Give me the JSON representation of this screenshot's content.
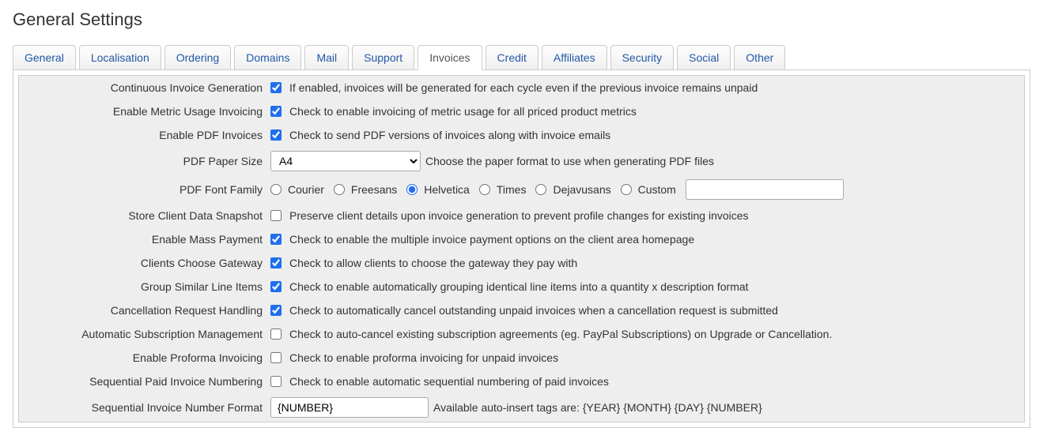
{
  "page_title": "General Settings",
  "tabs": {
    "general": "General",
    "localisation": "Localisation",
    "ordering": "Ordering",
    "domains": "Domains",
    "mail": "Mail",
    "support": "Support",
    "invoices": "Invoices",
    "credit": "Credit",
    "affiliates": "Affiliates",
    "security": "Security",
    "social": "Social",
    "other": "Other"
  },
  "rows": {
    "continuous": {
      "label": "Continuous Invoice Generation",
      "checked": true,
      "desc": "If enabled, invoices will be generated for each cycle even if the previous invoice remains unpaid"
    },
    "metric": {
      "label": "Enable Metric Usage Invoicing",
      "checked": true,
      "desc": "Check to enable invoicing of metric usage for all priced product metrics"
    },
    "pdf": {
      "label": "Enable PDF Invoices",
      "checked": true,
      "desc": "Check to send PDF versions of invoices along with invoice emails"
    },
    "papersize": {
      "label": "PDF Paper Size",
      "value": "A4",
      "desc": "Choose the paper format to use when generating PDF files"
    },
    "font": {
      "label": "PDF Font Family",
      "options": {
        "courier": "Courier",
        "freesans": "Freesans",
        "helvetica": "Helvetica",
        "times": "Times",
        "dejavusans": "Dejavusans",
        "custom": "Custom"
      },
      "selected": "helvetica",
      "custom_value": ""
    },
    "snapshot": {
      "label": "Store Client Data Snapshot",
      "checked": false,
      "desc": "Preserve client details upon invoice generation to prevent profile changes for existing invoices"
    },
    "masspay": {
      "label": "Enable Mass Payment",
      "checked": true,
      "desc": "Check to enable the multiple invoice payment options on the client area homepage"
    },
    "gateway": {
      "label": "Clients Choose Gateway",
      "checked": true,
      "desc": "Check to allow clients to choose the gateway they pay with"
    },
    "group": {
      "label": "Group Similar Line Items",
      "checked": true,
      "desc": "Check to enable automatically grouping identical line items into a quantity x description format"
    },
    "cancel": {
      "label": "Cancellation Request Handling",
      "checked": true,
      "desc": "Check to automatically cancel outstanding unpaid invoices when a cancellation request is submitted"
    },
    "subscription": {
      "label": "Automatic Subscription Management",
      "checked": false,
      "desc": "Check to auto-cancel existing subscription agreements (eg. PayPal Subscriptions) on Upgrade or Cancellation."
    },
    "proforma": {
      "label": "Enable Proforma Invoicing",
      "checked": false,
      "desc": "Check to enable proforma invoicing for unpaid invoices"
    },
    "seqpaid": {
      "label": "Sequential Paid Invoice Numbering",
      "checked": false,
      "desc": "Check to enable automatic sequential numbering of paid invoices"
    },
    "seqformat": {
      "label": "Sequential Invoice Number Format",
      "value": "{NUMBER}",
      "desc": "Available auto-insert tags are: {YEAR} {MONTH} {DAY} {NUMBER}"
    }
  }
}
